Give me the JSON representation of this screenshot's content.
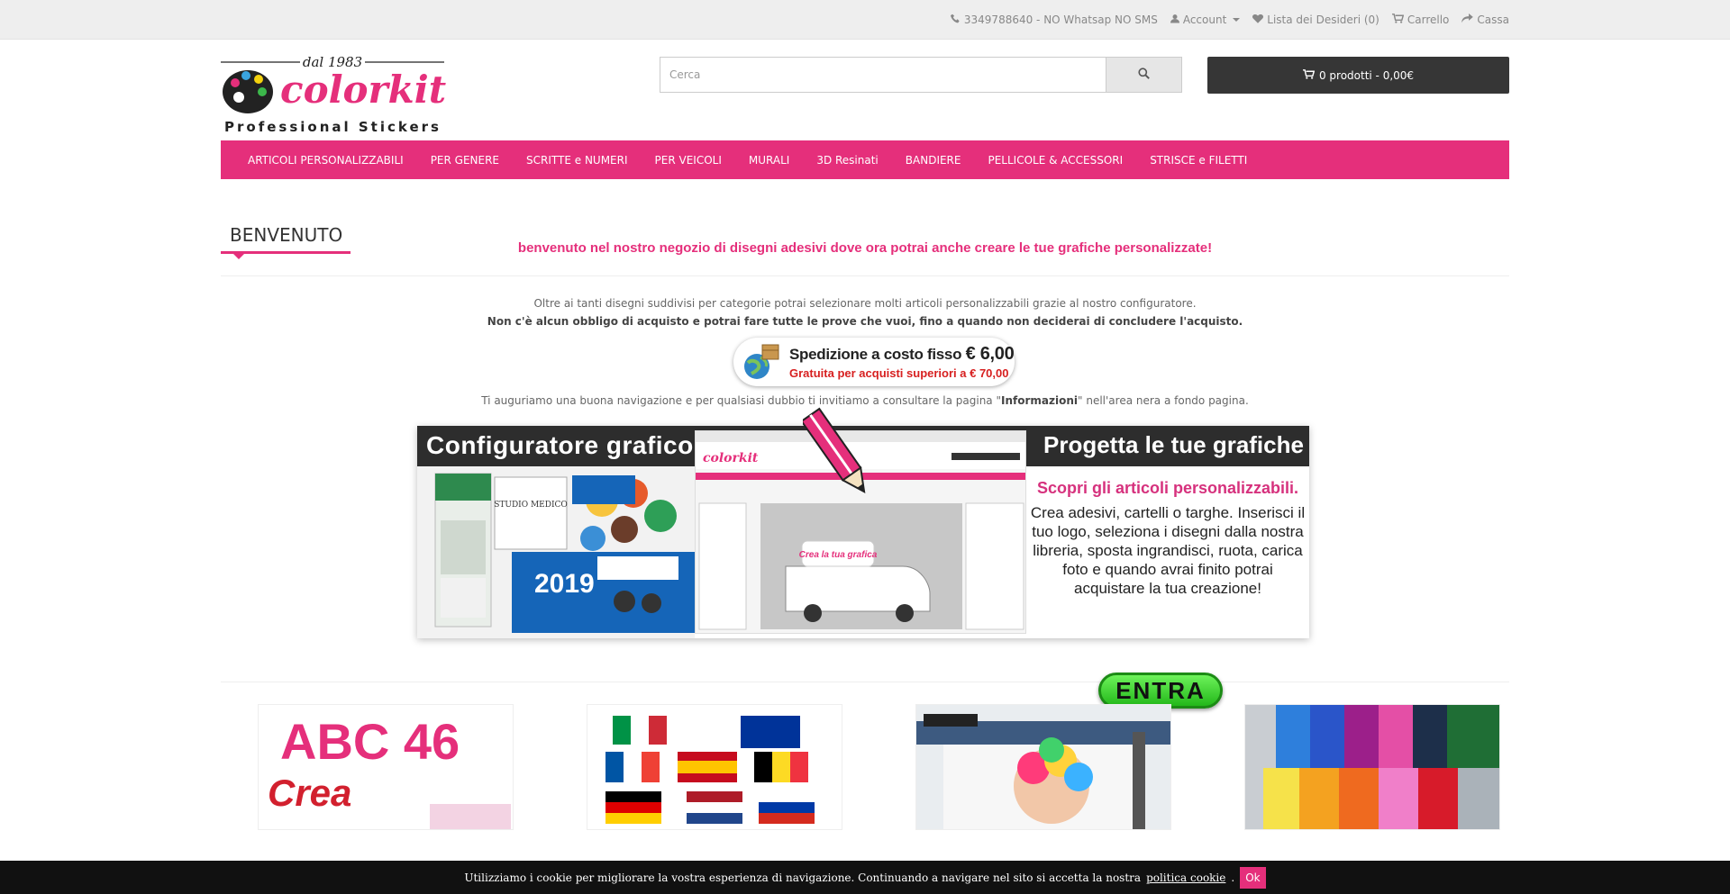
{
  "topbar": {
    "phone": "3349788640 - NO Whatsap NO SMS",
    "account": "Account",
    "wishlist": "Lista dei Desideri (0)",
    "cart": "Carrello",
    "checkout": "Cassa"
  },
  "logo": {
    "since": "dal 1983",
    "brand": "colorkit",
    "tagline": "Professional Stickers"
  },
  "search": {
    "placeholder": "Cerca"
  },
  "cart_button": {
    "label": "0 prodotti - 0,00€"
  },
  "nav": {
    "items": [
      "ARTICOLI PERSONALIZZABILI",
      "PER GENERE",
      "SCRITTE e NUMERI",
      "PER VEICOLI",
      "MURALI",
      "3D Resinati",
      "BANDIERE",
      "PELLICOLE & ACCESSORI",
      "STRISCE e FILETTI"
    ]
  },
  "welcome": {
    "title": "BENVENUTO",
    "subtitle": "benvenuto nel nostro negozio di disegni adesivi dove ora potrai anche creare le tue grafiche personalizzate!",
    "line1": "Oltre ai tanti disegni suddivisi per categorie potrai selezionare molti articoli personalizzabili grazie al nostro configuratore.",
    "line2": "Non c'è alcun obbligo di acquisto e potrai fare tutte le prove che vuoi, fino a quando non deciderai di concludere l'acquisto.",
    "line3_pre": "Ti auguriamo una buona navigazione e per qualsiasi dubbio ti invitiamo a consultare la pagina \"",
    "line3_bold": "Informazioni",
    "line3_post": "\" nell'area nera a fondo pagina."
  },
  "shipping": {
    "line1": "Spedizione a costo fisso",
    "price": "€ 6,00",
    "line2": "Gratuita per acquisti superiori a € 70,00"
  },
  "banner": {
    "title_left": "Configuratore grafico",
    "title_right": "Progetta le tue grafiche",
    "head": "Scopri gli articoli personalizzabili.",
    "body": "Crea adesivi, cartelli o targhe. Inserisci il tuo logo, seleziona i disegni dalla nostra libreria, sposta ingrandisci, ruota, carica foto e quando avrai finito potrai acquistare la tua creazione!",
    "cta": "ENTRA",
    "mockup_year": "2019",
    "mockup_sign": "STUDIO MEDICO",
    "mockup_van": "Crea la tua grafica"
  },
  "thumbs": {
    "t1_text1": "ABC 46",
    "t1_text2": "Crea"
  },
  "cookie": {
    "text": "Utilizziamo i cookie per migliorare la vostra esperienza di navigazione. Continuando a navigare nel sito si accetta la nostra",
    "link": "politica cookie",
    "dot": ".",
    "ok": "Ok"
  },
  "colors": {
    "accent": "#e52f7b",
    "dark": "#363636",
    "topbar": "#eeeeee"
  }
}
